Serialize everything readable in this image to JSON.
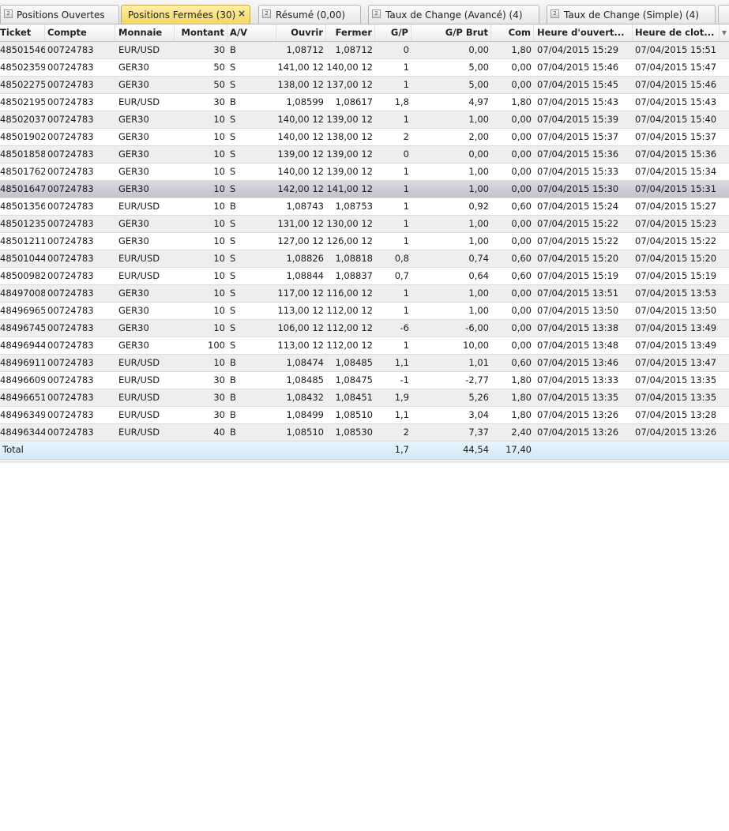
{
  "tabs": [
    {
      "label": "Positions Ouvertes",
      "icon": "panel-icon",
      "active": false
    },
    {
      "label": "Positions Fermées (30)",
      "icon": "",
      "active": true,
      "close": "×"
    },
    {
      "label": "Résumé (0,00)",
      "icon": "panel-icon",
      "active": false
    },
    {
      "label": "Taux de Change (Avancé) (4)",
      "icon": "panel-icon",
      "active": false
    },
    {
      "label": "Taux de Change (Simple) (4)",
      "icon": "panel-icon",
      "active": false
    }
  ],
  "columns": [
    "Ticket",
    "Compte",
    "Monnaie",
    "Montant",
    "A/V",
    "Ouvrir",
    "Fermer",
    "G/P",
    "G/P Brut",
    "Com",
    "Heure d'ouvert...",
    "Heure de clot..."
  ],
  "rows": [
    [
      "48501546",
      "00724783",
      "EUR/USD",
      "30",
      "B",
      "1,08712",
      "1,08712",
      "0",
      "0,00",
      "1,80",
      "07/04/2015 15:29",
      "07/04/2015 15:51"
    ],
    [
      "48502359",
      "00724783",
      "GER30",
      "50",
      "S",
      "12 141,00",
      "12 140,00",
      "1",
      "5,00",
      "0,00",
      "07/04/2015 15:46",
      "07/04/2015 15:47"
    ],
    [
      "48502275",
      "00724783",
      "GER30",
      "50",
      "S",
      "12 138,00",
      "12 137,00",
      "1",
      "5,00",
      "0,00",
      "07/04/2015 15:45",
      "07/04/2015 15:46"
    ],
    [
      "48502195",
      "00724783",
      "EUR/USD",
      "30",
      "B",
      "1,08599",
      "1,08617",
      "1,8",
      "4,97",
      "1,80",
      "07/04/2015 15:43",
      "07/04/2015 15:43"
    ],
    [
      "48502037",
      "00724783",
      "GER30",
      "10",
      "S",
      "12 140,00",
      "12 139,00",
      "1",
      "1,00",
      "0,00",
      "07/04/2015 15:39",
      "07/04/2015 15:40"
    ],
    [
      "48501902",
      "00724783",
      "GER30",
      "10",
      "S",
      "12 140,00",
      "12 138,00",
      "2",
      "2,00",
      "0,00",
      "07/04/2015 15:37",
      "07/04/2015 15:37"
    ],
    [
      "48501858",
      "00724783",
      "GER30",
      "10",
      "S",
      "12 139,00",
      "12 139,00",
      "0",
      "0,00",
      "0,00",
      "07/04/2015 15:36",
      "07/04/2015 15:36"
    ],
    [
      "48501762",
      "00724783",
      "GER30",
      "10",
      "S",
      "12 140,00",
      "12 139,00",
      "1",
      "1,00",
      "0,00",
      "07/04/2015 15:33",
      "07/04/2015 15:34"
    ],
    [
      "48501647",
      "00724783",
      "GER30",
      "10",
      "S",
      "12 142,00",
      "12 141,00",
      "1",
      "1,00",
      "0,00",
      "07/04/2015 15:30",
      "07/04/2015 15:31"
    ],
    [
      "48501356",
      "00724783",
      "EUR/USD",
      "10",
      "B",
      "1,08743",
      "1,08753",
      "1",
      "0,92",
      "0,60",
      "07/04/2015 15:24",
      "07/04/2015 15:27"
    ],
    [
      "48501235",
      "00724783",
      "GER30",
      "10",
      "S",
      "12 131,00",
      "12 130,00",
      "1",
      "1,00",
      "0,00",
      "07/04/2015 15:22",
      "07/04/2015 15:23"
    ],
    [
      "48501211",
      "00724783",
      "GER30",
      "10",
      "S",
      "12 127,00",
      "12 126,00",
      "1",
      "1,00",
      "0,00",
      "07/04/2015 15:22",
      "07/04/2015 15:22"
    ],
    [
      "48501044",
      "00724783",
      "EUR/USD",
      "10",
      "S",
      "1,08826",
      "1,08818",
      "0,8",
      "0,74",
      "0,60",
      "07/04/2015 15:20",
      "07/04/2015 15:20"
    ],
    [
      "48500982",
      "00724783",
      "EUR/USD",
      "10",
      "S",
      "1,08844",
      "1,08837",
      "0,7",
      "0,64",
      "0,60",
      "07/04/2015 15:19",
      "07/04/2015 15:19"
    ],
    [
      "48497008",
      "00724783",
      "GER30",
      "10",
      "S",
      "12 117,00",
      "12 116,00",
      "1",
      "1,00",
      "0,00",
      "07/04/2015 13:51",
      "07/04/2015 13:53"
    ],
    [
      "48496965",
      "00724783",
      "GER30",
      "10",
      "S",
      "12 113,00",
      "12 112,00",
      "1",
      "1,00",
      "0,00",
      "07/04/2015 13:50",
      "07/04/2015 13:50"
    ],
    [
      "48496745",
      "00724783",
      "GER30",
      "10",
      "S",
      "12 106,00",
      "12 112,00",
      "-6",
      "-6,00",
      "0,00",
      "07/04/2015 13:38",
      "07/04/2015 13:49"
    ],
    [
      "48496944",
      "00724783",
      "GER30",
      "100",
      "S",
      "12 113,00",
      "12 112,00",
      "1",
      "10,00",
      "0,00",
      "07/04/2015 13:48",
      "07/04/2015 13:49"
    ],
    [
      "48496911",
      "00724783",
      "EUR/USD",
      "10",
      "B",
      "1,08474",
      "1,08485",
      "1,1",
      "1,01",
      "0,60",
      "07/04/2015 13:46",
      "07/04/2015 13:47"
    ],
    [
      "48496609",
      "00724783",
      "EUR/USD",
      "30",
      "B",
      "1,08485",
      "1,08475",
      "-1",
      "-2,77",
      "1,80",
      "07/04/2015 13:33",
      "07/04/2015 13:35"
    ],
    [
      "48496651",
      "00724783",
      "EUR/USD",
      "30",
      "B",
      "1,08432",
      "1,08451",
      "1,9",
      "5,26",
      "1,80",
      "07/04/2015 13:35",
      "07/04/2015 13:35"
    ],
    [
      "48496349",
      "00724783",
      "EUR/USD",
      "30",
      "B",
      "1,08499",
      "1,08510",
      "1,1",
      "3,04",
      "1,80",
      "07/04/2015 13:26",
      "07/04/2015 13:28"
    ],
    [
      "48496344",
      "00724783",
      "EUR/USD",
      "40",
      "B",
      "1,08510",
      "1,08530",
      "2",
      "7,37",
      "2,40",
      "07/04/2015 13:26",
      "07/04/2015 13:26"
    ]
  ],
  "selected_row": 8,
  "total": {
    "label": "Total",
    "gp": "1,7",
    "gp_brut": "44,54",
    "com": "17,40"
  }
}
